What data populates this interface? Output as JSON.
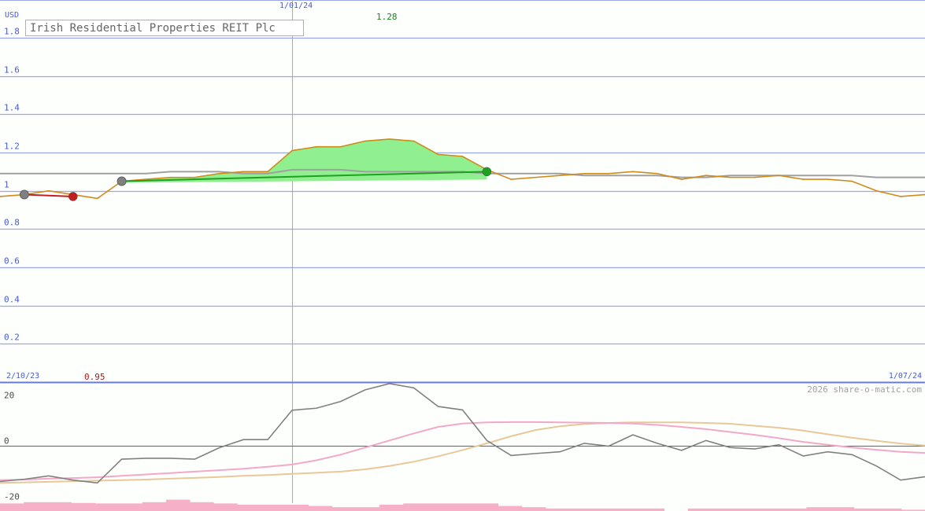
{
  "title": "Irish Residential Properties REIT Plc",
  "currency_label": "USD",
  "top_date_label": "1/01/24",
  "start_date_label": "2/10/23",
  "end_date_label": "1/07/24",
  "high_label": "1.28",
  "low_label": "0.95",
  "copyright": "2026 share-o-matic.com",
  "colors": {
    "price": "#d08a1a",
    "average": "#a0a0a0",
    "gain_fill": "#90f090",
    "gain_line": "#20a020",
    "loss_line": "#c02020",
    "grid": "#9aa8e8",
    "axis_text": "#4a5ad0",
    "high_text": "#208020",
    "low_text": "#a02020",
    "oscillator": "#808080",
    "osc_pink": "#f4a8c8",
    "osc_tan": "#e8c898",
    "volume": "#f6b0c8"
  },
  "chart_data": [
    {
      "type": "line",
      "ylabel": "USD",
      "ylim": [
        0,
        1.8
      ],
      "yticks": [
        "0.2",
        "0.4",
        "0.6",
        "0.8",
        "1",
        "1.2",
        "1.4",
        "1.6",
        "1.8"
      ],
      "ytick_values": [
        0.2,
        0.4,
        0.6,
        0.8,
        1.0,
        1.2,
        1.4,
        1.6,
        1.8
      ],
      "xlim": [
        0,
        38
      ],
      "x_date_marker": {
        "label": "1/01/24",
        "x": 12
      },
      "series": [
        {
          "key": "price",
          "values": [
            0.97,
            0.98,
            1.0,
            0.98,
            0.96,
            1.05,
            1.06,
            1.07,
            1.07,
            1.09,
            1.1,
            1.1,
            1.21,
            1.23,
            1.23,
            1.26,
            1.27,
            1.26,
            1.19,
            1.18,
            1.11,
            1.06,
            1.07,
            1.08,
            1.09,
            1.09,
            1.1,
            1.09,
            1.06,
            1.08,
            1.07,
            1.07,
            1.08,
            1.06,
            1.06,
            1.05,
            1.0,
            0.97,
            0.98
          ]
        },
        {
          "key": "average",
          "values": [
            1.09,
            1.09,
            1.09,
            1.09,
            1.09,
            1.09,
            1.09,
            1.1,
            1.1,
            1.1,
            1.09,
            1.09,
            1.11,
            1.11,
            1.11,
            1.1,
            1.1,
            1.1,
            1.1,
            1.1,
            1.09,
            1.09,
            1.09,
            1.09,
            1.08,
            1.08,
            1.08,
            1.08,
            1.07,
            1.07,
            1.08,
            1.08,
            1.08,
            1.08,
            1.08,
            1.08,
            1.07,
            1.07,
            1.07
          ]
        }
      ],
      "trades": [
        {
          "x0": 1,
          "y0": 0.98,
          "x1": 3,
          "y1": 0.97,
          "result": "loss"
        },
        {
          "x0": 5,
          "y0": 1.05,
          "x1": 20,
          "y1": 1.1,
          "result": "gain"
        }
      ],
      "annotations": [
        {
          "label": "1.28",
          "x": 16,
          "value": 1.28
        },
        {
          "label": "0.95",
          "x": 4,
          "value": 0.95
        }
      ]
    },
    {
      "type": "line",
      "ylim": [
        -20,
        20
      ],
      "yticks": [
        "20",
        "0",
        "-20"
      ],
      "ytick_values": [
        20,
        0,
        -20
      ],
      "xlim": [
        0,
        38
      ],
      "series": [
        {
          "key": "oscillator",
          "values": [
            -12.5,
            -11.7,
            -10.5,
            -12.0,
            -13.0,
            -4.6,
            -4.3,
            -4.3,
            -4.6,
            -0.6,
            2.3,
            2.3,
            12.7,
            13.4,
            15.8,
            19.9,
            22.1,
            20.6,
            14.0,
            12.8,
            2.0,
            -3.3,
            -2.6,
            -2.0,
            1.0,
            0.0,
            4.0,
            1.0,
            -1.5,
            2.0,
            -0.5,
            -1.0,
            0.5,
            -3.5,
            -2.0,
            -3.0,
            -7.0,
            -12.0,
            -10.8
          ]
        },
        {
          "key": "osc_pink",
          "values": [
            -12.0,
            -11.8,
            -11.5,
            -11.3,
            -11.0,
            -10.5,
            -10.0,
            -9.5,
            -9.0,
            -8.5,
            -8.0,
            -7.3,
            -6.5,
            -5.0,
            -3.0,
            -0.5,
            2.0,
            4.5,
            6.8,
            8.0,
            8.4,
            8.5,
            8.5,
            8.4,
            8.3,
            8.2,
            8.0,
            7.5,
            6.8,
            6.0,
            5.0,
            4.0,
            2.8,
            1.5,
            0.5,
            -0.5,
            -1.3,
            -2.0,
            -2.4
          ]
        },
        {
          "key": "osc_tan",
          "values": [
            -13.0,
            -12.8,
            -12.6,
            -12.4,
            -12.2,
            -12.0,
            -11.8,
            -11.5,
            -11.2,
            -10.9,
            -10.5,
            -10.2,
            -9.8,
            -9.4,
            -9.0,
            -8.2,
            -7.0,
            -5.5,
            -3.6,
            -1.4,
            1.0,
            3.5,
            5.7,
            7.0,
            7.8,
            8.2,
            8.4,
            8.4,
            8.4,
            8.2,
            7.9,
            7.2,
            6.5,
            5.5,
            4.2,
            3.0,
            1.9,
            0.9,
            0.2
          ]
        }
      ],
      "volume_bars": [
        3.0,
        3.5,
        3.5,
        3.2,
        3.0,
        3.0,
        3.5,
        4.5,
        3.5,
        3.0,
        2.5,
        2.5,
        2.5,
        2.0,
        1.5,
        1.5,
        2.5,
        3.0,
        3.0,
        3.0,
        3.0,
        2.0,
        1.5,
        1.0,
        1.0,
        1.0,
        1.0,
        1.0,
        0.0,
        1.0,
        1.0,
        1.0,
        1.0,
        1.0,
        1.5,
        1.5,
        1.0,
        1.0,
        0.5
      ]
    }
  ]
}
